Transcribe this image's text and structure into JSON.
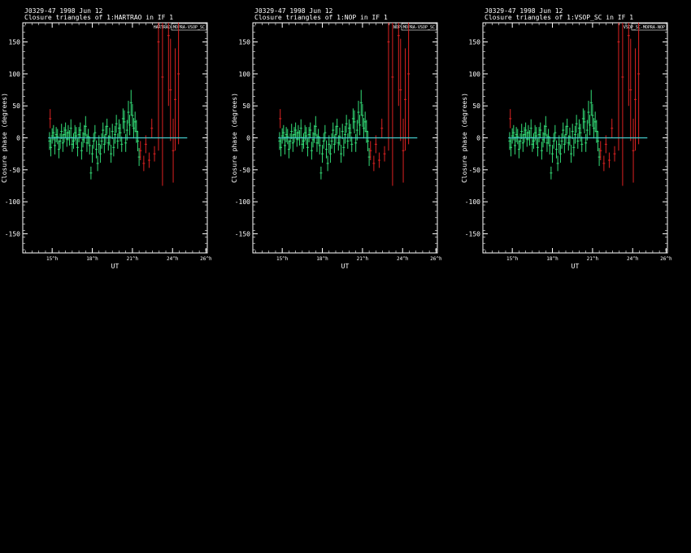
{
  "chart_data": [
    {
      "type": "scatter",
      "title": "J0329-47  1998 Jun 12",
      "subtitle": "Closure triangles of 1:HARTRAO in IF 1",
      "xlabel": "UT",
      "ylabel": "Closure phase  (degrees)",
      "ylim": [
        -180,
        180
      ],
      "xlim": [
        -8.2,
        5.6
      ],
      "xtick_values": [
        -6,
        -3,
        0,
        3,
        5.5
      ],
      "xtick_labels": [
        "15^h",
        "18^h",
        "21^h",
        "24^h",
        "26^h"
      ],
      "ytick_values": [
        150,
        100,
        50,
        0,
        -50,
        -100,
        -150
      ],
      "ytick_labels": [
        "150",
        "100",
        "50",
        "0",
        "-50",
        "-100",
        "-150"
      ],
      "legend": "HARTRAO-MOPRA-VSOP_SC",
      "model_line": {
        "y": 0,
        "x": [
          -6.3,
          4.1
        ],
        "color": "#44cccc"
      },
      "series": [
        {
          "color": "#33dd77",
          "x": [
            -6.2,
            -6.1,
            -6.0,
            -5.9,
            -5.8,
            -5.7,
            -5.6,
            -5.5,
            -5.4,
            -5.3,
            -5.2,
            -5.1,
            -5.0,
            -4.9,
            -4.8,
            -4.7,
            -4.6,
            -4.5,
            -4.4,
            -4.3,
            -4.2,
            -4.1,
            -4.0,
            -3.9,
            -3.8,
            -3.7,
            -3.6,
            -3.5,
            -3.4,
            -3.3,
            -3.2,
            -3.1,
            -3.0,
            -2.9,
            -2.8,
            -2.7,
            -2.6,
            -2.5,
            -2.4,
            -2.3,
            -2.2,
            -2.1,
            -2.0,
            -1.9,
            -1.8,
            -1.7,
            -1.6,
            -1.5,
            -1.4,
            -1.3,
            -1.2,
            -1.1,
            -1.0,
            -0.9,
            -0.8,
            -0.7,
            -0.6,
            -0.5,
            -0.4,
            -0.3,
            -0.2,
            -0.1,
            0.0,
            0.1,
            0.2,
            0.3,
            0.4,
            0.5
          ],
          "y": [
            -5,
            -15,
            3,
            8,
            -12,
            5,
            2,
            -18,
            -5,
            10,
            -8,
            5,
            12,
            -2,
            8,
            0,
            15,
            -10,
            -5,
            8,
            3,
            -15,
            5,
            12,
            -20,
            -3,
            6,
            18,
            -8,
            2,
            -12,
            -55,
            -25,
            -5,
            8,
            -18,
            -40,
            -10,
            -25,
            -5,
            12,
            -10,
            5,
            18,
            -8,
            2,
            -25,
            10,
            -15,
            5,
            22,
            -5,
            15,
            8,
            -10,
            30,
            25,
            -8,
            12,
            40,
            20,
            55,
            35,
            15,
            25,
            10,
            -5,
            -30
          ],
          "err": [
            14,
            14,
            12,
            12,
            14,
            12,
            12,
            14,
            12,
            12,
            14,
            12,
            12,
            12,
            12,
            12,
            14,
            12,
            12,
            12,
            14,
            14,
            12,
            12,
            14,
            12,
            14,
            16,
            14,
            12,
            14,
            10,
            14,
            12,
            12,
            14,
            12,
            14,
            14,
            12,
            12,
            14,
            14,
            12,
            12,
            14,
            14,
            12,
            14,
            14,
            14,
            12,
            14,
            14,
            12,
            16,
            18,
            14,
            16,
            18,
            16,
            20,
            18,
            16,
            16,
            18,
            16,
            14
          ]
        },
        {
          "color": "#dd2222",
          "x": [
            -6.15,
            0.6,
            0.85,
            1.0,
            1.25,
            1.45,
            1.65,
            1.95,
            2.25,
            2.7,
            2.85,
            3.05,
            3.2,
            3.45
          ],
          "y": [
            30,
            -20,
            -40,
            -10,
            -35,
            15,
            -25,
            150,
            95,
            160,
            75,
            -20,
            60,
            100
          ],
          "err": [
            15,
            15,
            12,
            14,
            12,
            15,
            12,
            170,
            170,
            110,
            80,
            50,
            80,
            110
          ]
        }
      ]
    },
    {
      "type": "scatter",
      "title": "J0329-47  1998 Jun 12",
      "subtitle": "Closure triangles of 1:NOP in IF 1",
      "xlabel": "UT",
      "ylabel": "Closure phase  (degrees)",
      "ylim": [
        -180,
        180
      ],
      "xlim": [
        -8.2,
        5.6
      ],
      "xtick_values": [
        -6,
        -3,
        0,
        3,
        5.5
      ],
      "xtick_labels": [
        "15^h",
        "18^h",
        "21^h",
        "24^h",
        "26^h"
      ],
      "ytick_values": [
        150,
        100,
        50,
        0,
        -50,
        -100,
        -150
      ],
      "ytick_labels": [
        "150",
        "100",
        "50",
        "0",
        "-50",
        "-100",
        "-150"
      ],
      "legend": "NOP-MOPRA-VSOP_SC",
      "model_line": {
        "y": 0,
        "x": [
          -6.3,
          4.1
        ],
        "color": "#44cccc"
      },
      "series": [
        {
          "color": "#33dd77",
          "x": [
            -6.2,
            -6.1,
            -6.0,
            -5.9,
            -5.8,
            -5.7,
            -5.6,
            -5.5,
            -5.4,
            -5.3,
            -5.2,
            -5.1,
            -5.0,
            -4.9,
            -4.8,
            -4.7,
            -4.6,
            -4.5,
            -4.4,
            -4.3,
            -4.2,
            -4.1,
            -4.0,
            -3.9,
            -3.8,
            -3.7,
            -3.6,
            -3.5,
            -3.4,
            -3.3,
            -3.2,
            -3.1,
            -3.0,
            -2.9,
            -2.8,
            -2.7,
            -2.6,
            -2.5,
            -2.4,
            -2.3,
            -2.2,
            -2.1,
            -2.0,
            -1.9,
            -1.8,
            -1.7,
            -1.6,
            -1.5,
            -1.4,
            -1.3,
            -1.2,
            -1.1,
            -1.0,
            -0.9,
            -0.8,
            -0.7,
            -0.6,
            -0.5,
            -0.4,
            -0.3,
            -0.2,
            -0.1,
            0.0,
            0.1,
            0.2,
            0.3,
            0.4,
            0.5
          ],
          "y": [
            -5,
            -15,
            3,
            8,
            -12,
            5,
            2,
            -18,
            -5,
            10,
            -8,
            5,
            12,
            -2,
            8,
            0,
            15,
            -10,
            -5,
            8,
            3,
            -15,
            5,
            12,
            -20,
            -3,
            6,
            18,
            -8,
            2,
            -12,
            -55,
            -25,
            -5,
            8,
            -18,
            -40,
            -10,
            -25,
            -5,
            12,
            -10,
            5,
            18,
            -8,
            2,
            -25,
            10,
            -15,
            5,
            22,
            -5,
            15,
            8,
            -10,
            30,
            25,
            -8,
            12,
            40,
            20,
            55,
            35,
            15,
            25,
            10,
            -5,
            -30
          ],
          "err": [
            14,
            14,
            12,
            12,
            14,
            12,
            12,
            14,
            12,
            12,
            14,
            12,
            12,
            12,
            12,
            12,
            14,
            12,
            12,
            12,
            14,
            14,
            12,
            12,
            14,
            12,
            14,
            16,
            14,
            12,
            14,
            10,
            14,
            12,
            12,
            14,
            12,
            14,
            14,
            12,
            12,
            14,
            14,
            12,
            12,
            14,
            14,
            12,
            14,
            14,
            14,
            12,
            14,
            14,
            12,
            16,
            18,
            14,
            16,
            18,
            16,
            20,
            18,
            16,
            16,
            18,
            16,
            14
          ]
        },
        {
          "color": "#dd2222",
          "x": [
            -6.15,
            0.6,
            0.85,
            1.0,
            1.25,
            1.45,
            1.65,
            1.95,
            2.25,
            2.7,
            2.85,
            3.05,
            3.2,
            3.45
          ],
          "y": [
            30,
            -20,
            -40,
            -10,
            -35,
            15,
            -25,
            150,
            95,
            160,
            75,
            -20,
            60,
            100
          ],
          "err": [
            15,
            15,
            12,
            14,
            12,
            15,
            12,
            170,
            170,
            110,
            80,
            50,
            80,
            110
          ]
        }
      ]
    },
    {
      "type": "scatter",
      "title": "J0329-47  1998 Jun 12",
      "subtitle": "Closure triangles of 1:VSOP_SC in IF 1",
      "xlabel": "UT",
      "ylabel": "Closure phase  (degrees)",
      "ylim": [
        -180,
        180
      ],
      "xlim": [
        -8.2,
        5.6
      ],
      "xtick_values": [
        -6,
        -3,
        0,
        3,
        5.5
      ],
      "xtick_labels": [
        "15^h",
        "18^h",
        "21^h",
        "24^h",
        "26^h"
      ],
      "ytick_values": [
        150,
        100,
        50,
        0,
        -50,
        -100,
        -150
      ],
      "ytick_labels": [
        "150",
        "100",
        "50",
        "0",
        "-50",
        "-100",
        "-150"
      ],
      "legend": "VSOP_SC-MOPRA-NOP",
      "model_line": {
        "y": 0,
        "x": [
          -6.3,
          4.1
        ],
        "color": "#44cccc"
      },
      "series": [
        {
          "color": "#33dd77",
          "x": [
            -6.2,
            -6.1,
            -6.0,
            -5.9,
            -5.8,
            -5.7,
            -5.6,
            -5.5,
            -5.4,
            -5.3,
            -5.2,
            -5.1,
            -5.0,
            -4.9,
            -4.8,
            -4.7,
            -4.6,
            -4.5,
            -4.4,
            -4.3,
            -4.2,
            -4.1,
            -4.0,
            -3.9,
            -3.8,
            -3.7,
            -3.6,
            -3.5,
            -3.4,
            -3.3,
            -3.2,
            -3.1,
            -3.0,
            -2.9,
            -2.8,
            -2.7,
            -2.6,
            -2.5,
            -2.4,
            -2.3,
            -2.2,
            -2.1,
            -2.0,
            -1.9,
            -1.8,
            -1.7,
            -1.6,
            -1.5,
            -1.4,
            -1.3,
            -1.2,
            -1.1,
            -1.0,
            -0.9,
            -0.8,
            -0.7,
            -0.6,
            -0.5,
            -0.4,
            -0.3,
            -0.2,
            -0.1,
            0.0,
            0.1,
            0.2,
            0.3,
            0.4,
            0.5
          ],
          "y": [
            -5,
            -15,
            3,
            8,
            -12,
            5,
            2,
            -18,
            -5,
            10,
            -8,
            5,
            12,
            -2,
            8,
            0,
            15,
            -10,
            -5,
            8,
            3,
            -15,
            5,
            12,
            -20,
            -3,
            6,
            18,
            -8,
            2,
            -12,
            -55,
            -25,
            -5,
            8,
            -18,
            -40,
            -10,
            -25,
            -5,
            12,
            -10,
            5,
            18,
            -8,
            2,
            -25,
            10,
            -15,
            5,
            22,
            -5,
            15,
            8,
            -10,
            30,
            25,
            -8,
            12,
            40,
            20,
            55,
            35,
            15,
            25,
            10,
            -5,
            -30
          ],
          "err": [
            14,
            14,
            12,
            12,
            14,
            12,
            12,
            14,
            12,
            12,
            14,
            12,
            12,
            12,
            12,
            12,
            14,
            12,
            12,
            12,
            14,
            14,
            12,
            12,
            14,
            12,
            14,
            16,
            14,
            12,
            14,
            10,
            14,
            12,
            12,
            14,
            12,
            14,
            14,
            12,
            12,
            14,
            14,
            12,
            12,
            14,
            14,
            12,
            14,
            14,
            14,
            12,
            14,
            14,
            12,
            16,
            18,
            14,
            16,
            18,
            16,
            20,
            18,
            16,
            16,
            18,
            16,
            14
          ]
        },
        {
          "color": "#dd2222",
          "x": [
            -6.15,
            0.6,
            0.85,
            1.0,
            1.25,
            1.45,
            1.65,
            1.95,
            2.25,
            2.7,
            2.85,
            3.05,
            3.2,
            3.45
          ],
          "y": [
            30,
            -20,
            -40,
            -10,
            -35,
            15,
            -25,
            150,
            95,
            160,
            75,
            -20,
            60,
            100
          ],
          "err": [
            15,
            15,
            12,
            14,
            12,
            15,
            12,
            170,
            170,
            110,
            80,
            50,
            80,
            110
          ]
        }
      ]
    }
  ]
}
